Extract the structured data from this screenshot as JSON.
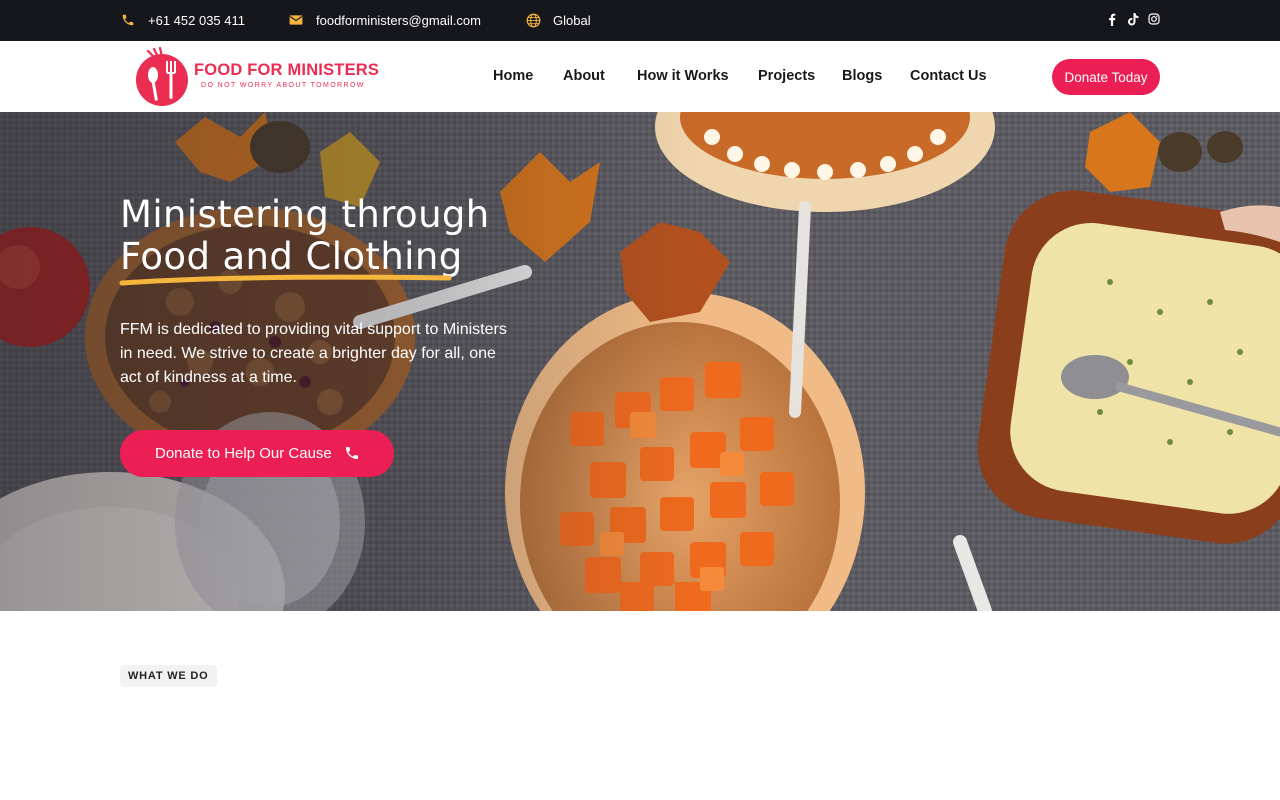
{
  "topbar": {
    "phone": "+61 452 035 411",
    "email": "foodforministers@gmail.com",
    "region": "Global",
    "phone_icon": "phone-icon",
    "email_icon": "mail-icon",
    "globe_icon": "globe-icon",
    "social": [
      "facebook-icon",
      "tiktok-icon",
      "instagram-icon"
    ],
    "accent": "#f4b63c"
  },
  "header": {
    "logo_title": "FOOD FOR MINISTERS",
    "logo_tagline": "DO NOT WORRY ABOUT TOMORROW",
    "nav": [
      "Home",
      "About",
      "How it Works",
      "Projects",
      "Blogs",
      "Contact Us"
    ],
    "donate_label": "Donate Today"
  },
  "hero": {
    "title_line1": "Ministering through",
    "title_line2": "Food and Clothing",
    "description": "FFM is dedicated to providing vital support to Ministers in need. We strive to create a brighter day for all, one act of kindness at a time.",
    "cta_label": "Donate to Help Our Cause",
    "cta_icon": "phone-icon"
  },
  "section": {
    "eyebrow": "WHAT WE DO"
  },
  "colors": {
    "brand": "#ec1f54",
    "topbar_bg": "#16161d",
    "highlight": "#f4b63c"
  }
}
